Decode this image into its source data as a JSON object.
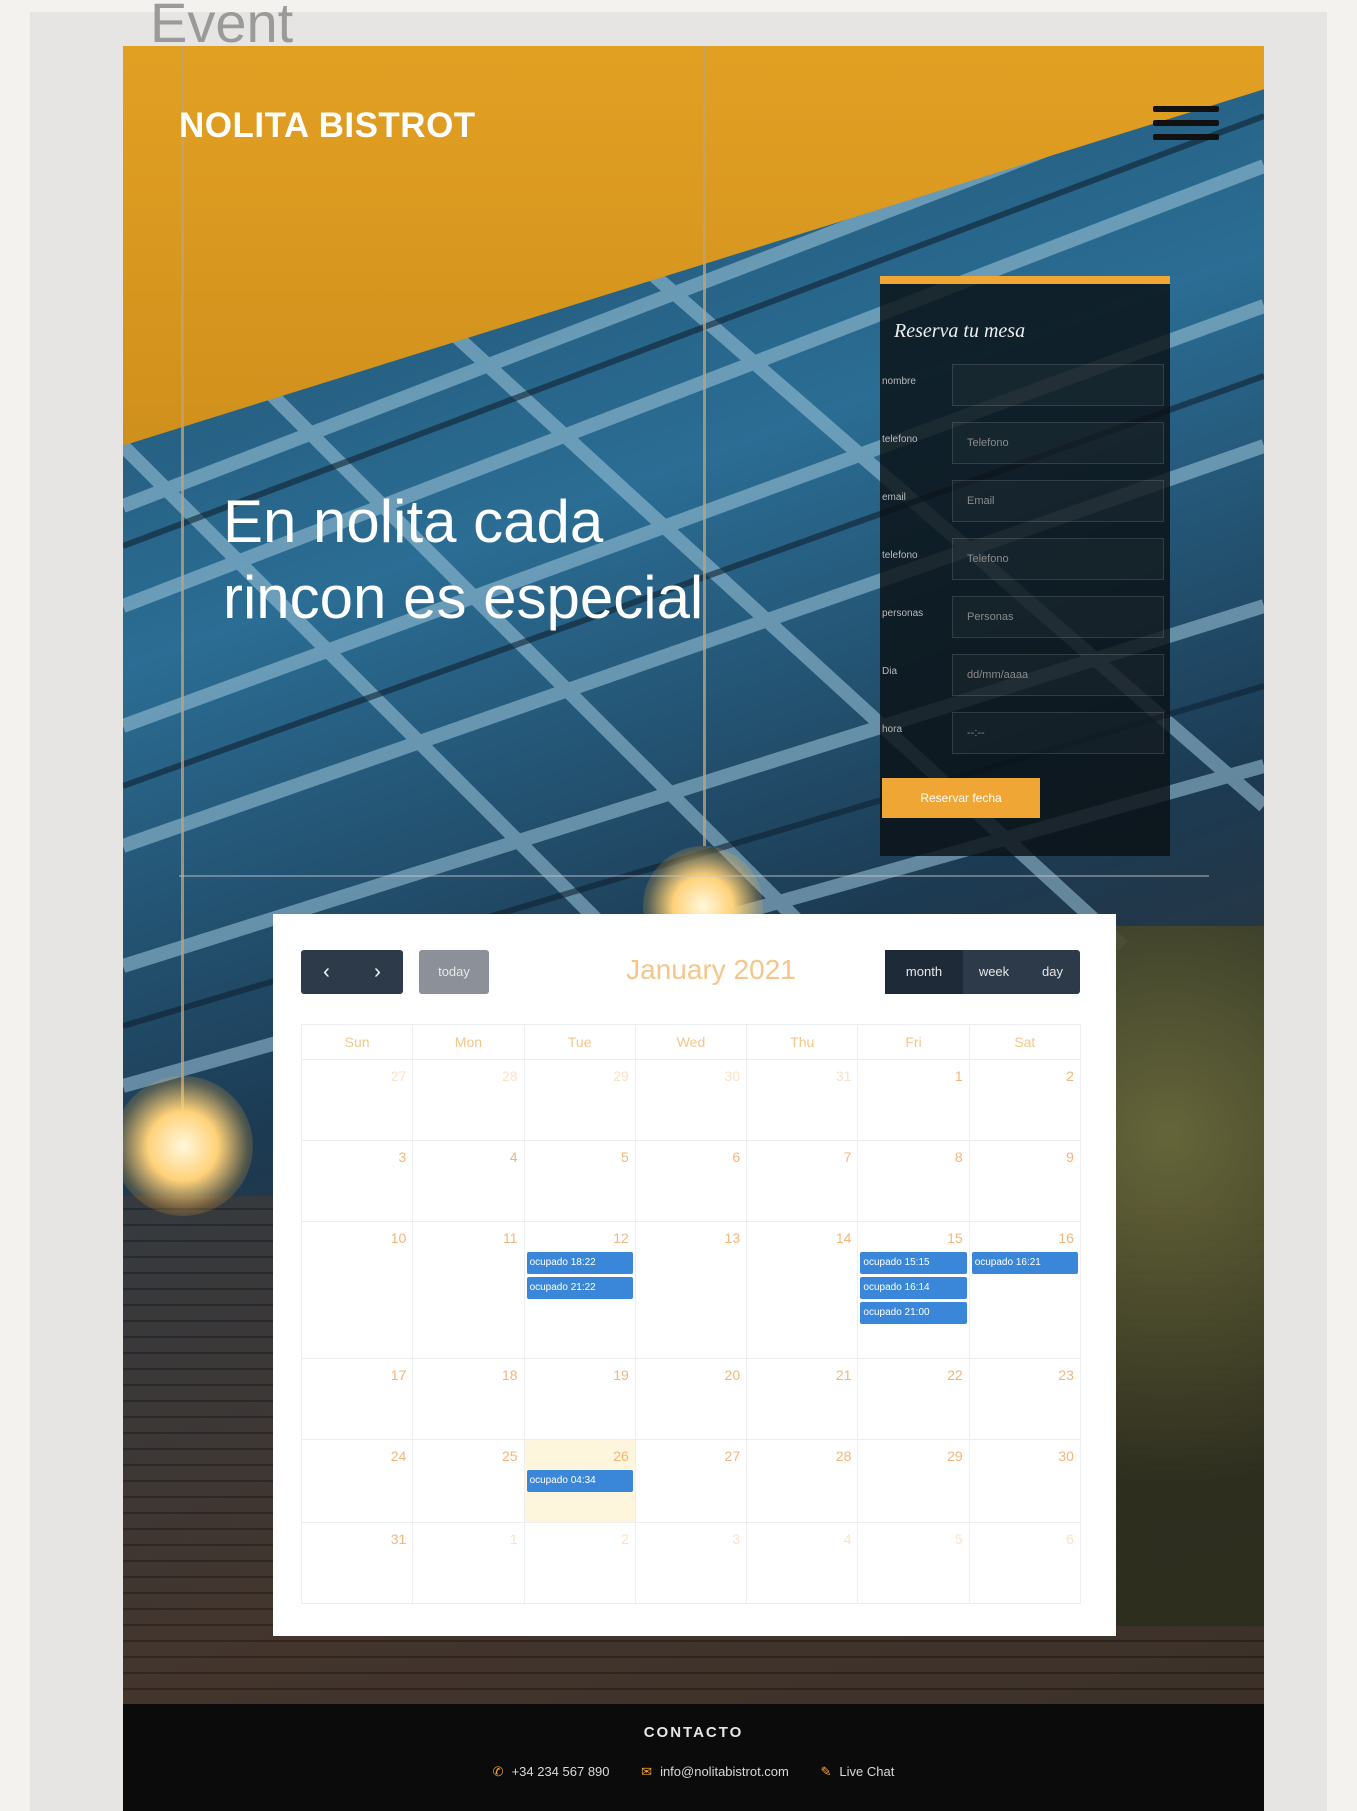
{
  "page": {
    "heading": "Event"
  },
  "header": {
    "brand": "NOLITA BISTROT",
    "menu_icon": "hamburger-icon"
  },
  "hero": {
    "title_line1": "En nolita cada",
    "title_line2": "rincon es especial"
  },
  "reservation": {
    "title": "Reserva tu mesa",
    "fields": [
      {
        "label": "nombre",
        "placeholder": ""
      },
      {
        "label": "telefono",
        "placeholder": "Telefono"
      },
      {
        "label": "email",
        "placeholder": "Email"
      },
      {
        "label": "telefono",
        "placeholder": "Telefono"
      },
      {
        "label": "personas",
        "placeholder": "Personas"
      },
      {
        "label": "Dia",
        "placeholder": "dd/mm/aaaa"
      },
      {
        "label": "hora",
        "placeholder": "--:--"
      }
    ],
    "submit_label": "Reservar fecha"
  },
  "calendar": {
    "title": "January 2021",
    "prev_icon": "chevron-left-icon",
    "next_icon": "chevron-right-icon",
    "today_label": "today",
    "views": [
      "month",
      "week",
      "day"
    ],
    "active_view": "month",
    "weekdays": [
      "Sun",
      "Mon",
      "Tue",
      "Wed",
      "Thu",
      "Fri",
      "Sat"
    ],
    "event_color": "#3a87d9",
    "today_color": "#fdf5dc",
    "weeks": [
      {
        "height": 80,
        "days": [
          {
            "n": "27",
            "other": true,
            "events": []
          },
          {
            "n": "28",
            "other": true,
            "events": []
          },
          {
            "n": "29",
            "other": true,
            "events": []
          },
          {
            "n": "30",
            "other": true,
            "events": []
          },
          {
            "n": "31",
            "other": true,
            "events": []
          },
          {
            "n": "1",
            "other": false,
            "events": []
          },
          {
            "n": "2",
            "other": false,
            "events": []
          }
        ]
      },
      {
        "height": 80,
        "days": [
          {
            "n": "3",
            "events": []
          },
          {
            "n": "4",
            "events": []
          },
          {
            "n": "5",
            "events": []
          },
          {
            "n": "6",
            "events": []
          },
          {
            "n": "7",
            "events": []
          },
          {
            "n": "8",
            "events": []
          },
          {
            "n": "9",
            "events": []
          }
        ]
      },
      {
        "height": 136,
        "days": [
          {
            "n": "10",
            "events": []
          },
          {
            "n": "11",
            "events": []
          },
          {
            "n": "12",
            "events": [
              "ocupado 18:22",
              "ocupado 21:22"
            ]
          },
          {
            "n": "13",
            "events": []
          },
          {
            "n": "14",
            "events": []
          },
          {
            "n": "15",
            "events": [
              "ocupado 15:15",
              "ocupado 16:14",
              "ocupado 21:00"
            ]
          },
          {
            "n": "16",
            "events": [
              "ocupado 16:21"
            ]
          }
        ]
      },
      {
        "height": 80,
        "days": [
          {
            "n": "17",
            "events": []
          },
          {
            "n": "18",
            "events": []
          },
          {
            "n": "19",
            "events": []
          },
          {
            "n": "20",
            "events": []
          },
          {
            "n": "21",
            "events": []
          },
          {
            "n": "22",
            "events": []
          },
          {
            "n": "23",
            "events": []
          }
        ]
      },
      {
        "height": 82,
        "days": [
          {
            "n": "24",
            "events": []
          },
          {
            "n": "25",
            "events": []
          },
          {
            "n": "26",
            "today": true,
            "events": [
              "ocupado 04:34"
            ]
          },
          {
            "n": "27",
            "events": []
          },
          {
            "n": "28",
            "events": []
          },
          {
            "n": "29",
            "events": []
          },
          {
            "n": "30",
            "events": []
          }
        ]
      },
      {
        "height": 80,
        "days": [
          {
            "n": "31",
            "events": []
          },
          {
            "n": "1",
            "other": true,
            "events": []
          },
          {
            "n": "2",
            "other": true,
            "events": []
          },
          {
            "n": "3",
            "other": true,
            "events": []
          },
          {
            "n": "4",
            "other": true,
            "events": []
          },
          {
            "n": "5",
            "other": true,
            "events": []
          },
          {
            "n": "6",
            "other": true,
            "events": []
          }
        ]
      }
    ]
  },
  "footer": {
    "title": "CONTACTO",
    "phone": "+34 234 567 890",
    "email": "info@nolitabistrot.com",
    "chat": "Live Chat"
  },
  "colors": {
    "accent": "#f0a635",
    "calendar_text": "#f4b57a",
    "footer_bg": "#0b0b0b"
  }
}
